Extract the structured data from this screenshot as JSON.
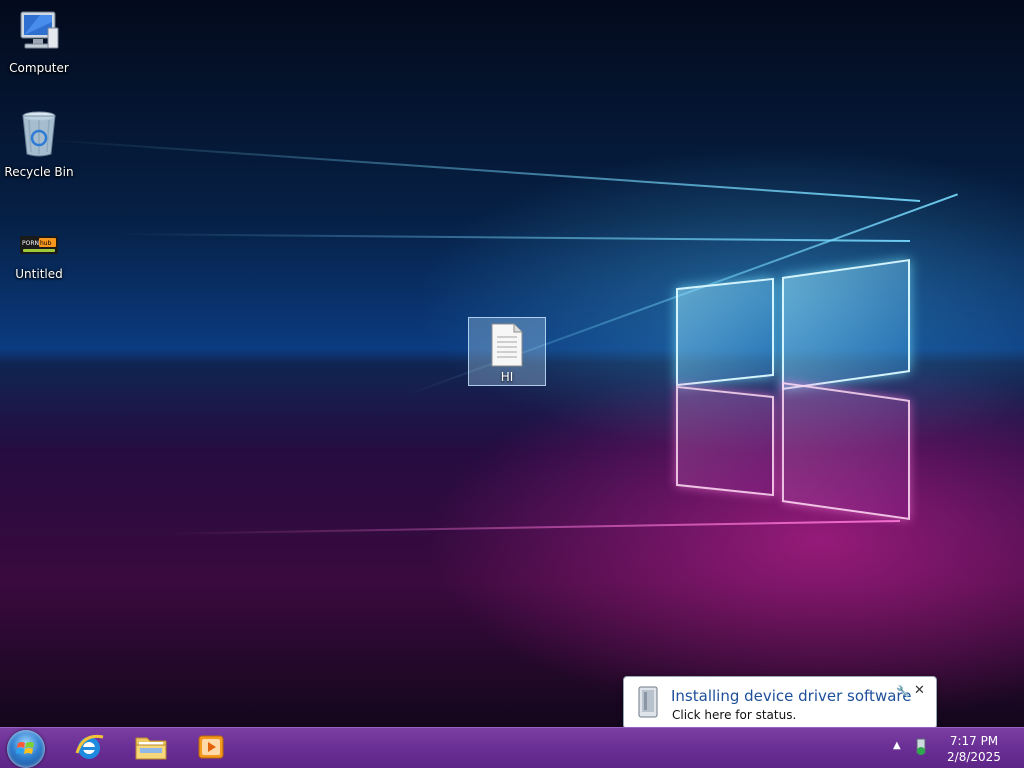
{
  "desktop": {
    "icons": [
      {
        "label": "Computer",
        "icon": "computer-icon"
      },
      {
        "label": "Recycle Bin",
        "icon": "recycle-bin-icon"
      },
      {
        "label": "Untitled",
        "icon": "untitled-app-icon",
        "logo_text": "PORNhub"
      }
    ],
    "selected_file": {
      "label": "HI",
      "icon": "text-document-icon"
    }
  },
  "notification": {
    "title": "Installing device driver software",
    "body": "Click here for status.",
    "icon": "device-driver-icon"
  },
  "taskbar": {
    "start": "start-button",
    "pinned": [
      {
        "name": "internet-explorer",
        "icon": "internet-explorer-icon"
      },
      {
        "name": "file-explorer",
        "icon": "folder-icon"
      },
      {
        "name": "media-player",
        "icon": "media-player-icon"
      }
    ],
    "tray": {
      "show_hidden_icon": "chevron-up-icon",
      "driver_icon": "device-install-icon",
      "time": "7:17 PM",
      "date": "2/8/2025"
    }
  },
  "colors": {
    "taskbar": "#6a2f94",
    "notification_title": "#1d4f9a"
  }
}
